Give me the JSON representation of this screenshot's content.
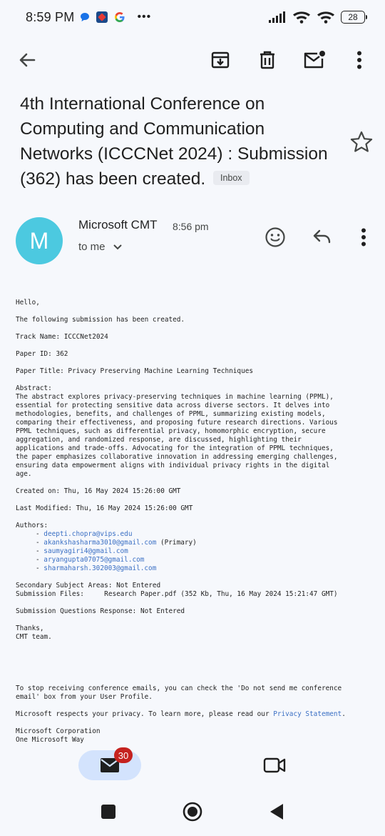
{
  "status_bar": {
    "time": "8:59 PM",
    "battery": "28",
    "icons": [
      "chat-bubble-icon",
      "app-icon",
      "google-icon",
      "more-dots-icon",
      "signal-icon",
      "wifi-icon",
      "wifi-icon"
    ]
  },
  "toolbar": {
    "icons": [
      "back-arrow-icon",
      "archive-icon",
      "delete-icon",
      "mark-unread-icon",
      "more-vert-icon"
    ]
  },
  "email": {
    "subject": "4th International Conference on Computing and Communication Networks (ICCCNet 2024) : Submission (362) has been created.",
    "label": "Inbox",
    "sender": {
      "initial": "M",
      "name": "Microsoft CMT",
      "time": "8:56 pm",
      "to": "to me",
      "avatar_color": "#4cc9e0"
    },
    "body": {
      "greeting": "Hello,",
      "intro": "The following submission has been created.",
      "track": "Track Name: ICCCNet2024",
      "paper_id": "Paper ID: 362",
      "paper_title": "Paper Title: Privacy Preserving Machine Learning Techniques",
      "abstract_label": "Abstract:",
      "abstract": "The abstract explores privacy-preserving techniques in machine learning (PPML),\nessential for protecting sensitive data across diverse sectors. It delves into\nmethodologies, benefits, and challenges of PPML, summarizing existing models,\ncomparing their effectiveness, and proposing future research directions. Various\nPPML techniques, such as differential privacy, homomorphic encryption, secure\naggregation, and randomized response, are discussed, highlighting their\napplications and trade-offs. Advocating for the integration of PPML techniques,\nthe paper emphasizes collaborative innovation in addressing emerging challenges,\nensuring data empowerment aligns with individual privacy rights in the digital\nage.",
      "created_on": "Created on: Thu, 16 May 2024 15:26:00 GMT",
      "last_modified": "Last Modified: Thu, 16 May 2024 15:26:00 GMT",
      "authors_label": "Authors:",
      "authors": [
        {
          "email": "deepti.chopra@vips.edu",
          "note": ""
        },
        {
          "email": "akankshasharma3010@gmail.com",
          "note": " (Primary)"
        },
        {
          "email": "saumyagiri4@gmail.com",
          "note": ""
        },
        {
          "email": "aryangupta07075@gmail.com",
          "note": ""
        },
        {
          "email": "sharmaharsh.302003@gmail.com",
          "note": ""
        }
      ],
      "secondary_areas": "Secondary Subject Areas: Not Entered",
      "submission_files": "Submission Files:     Research Paper.pdf (352 Kb, Thu, 16 May 2024 15:21:47 GMT)",
      "questions_response": "Submission Questions Response: Not Entered",
      "thanks": "Thanks,\nCMT team.",
      "unsubscribe": "To stop receiving conference emails, you can check the 'Do not send me conference\nemail' box from your User Profile.",
      "privacy_text": "Microsoft respects your privacy. To learn more, please read our ",
      "privacy_link": "Privacy Statement",
      "privacy_end": ".",
      "company": "Microsoft Corporation\nOne Microsoft Way"
    }
  },
  "bottom_nav": {
    "mail_badge": "30"
  },
  "colors": {
    "background": "#f6f8fc",
    "link": "#3a6fc4",
    "badge": "#c5221f",
    "pill": "#d3e3fd"
  }
}
